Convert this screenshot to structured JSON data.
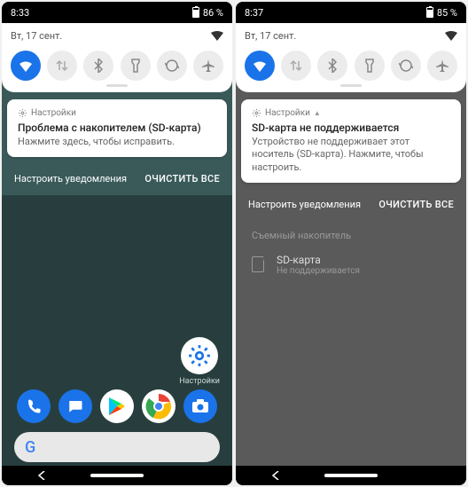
{
  "left": {
    "status": {
      "time": "8:33",
      "battery": "86 %"
    },
    "date": "Вт, 17 сент.",
    "qs": [
      "wifi",
      "data",
      "bluetooth",
      "flashlight",
      "rotate",
      "airplane"
    ],
    "notif": {
      "app": "Настройки",
      "title": "Проблема с накопителем (SD-карта)",
      "body": "Нажмите здесь, чтобы исправить."
    },
    "footer": {
      "manage": "Настроить уведомления",
      "clear": "ОЧИСТИТЬ ВСЕ"
    },
    "settings_label": "Настройки"
  },
  "right": {
    "status": {
      "time": "8:37",
      "battery": "85 %"
    },
    "date": "Вт, 17 сент.",
    "qs": [
      "wifi",
      "data",
      "bluetooth",
      "flashlight",
      "rotate",
      "airplane"
    ],
    "notif": {
      "app": "Настройки",
      "title": "SD-карта не поддерживается",
      "body": "Устройство не поддерживает этот носитель (SD-карта). Нажмите, чтобы настроить."
    },
    "footer": {
      "manage": "Настроить уведомления",
      "clear": "ОЧИСТИТЬ ВСЕ"
    },
    "section": "Съемный накопитель",
    "row": {
      "title": "SD-карта",
      "sub": "Не поддерживается"
    }
  }
}
